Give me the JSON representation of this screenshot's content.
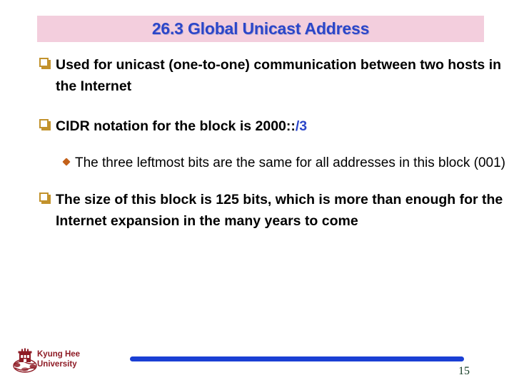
{
  "slide": {
    "page_number": "15",
    "title": "26.3 Global Unicast Address",
    "title_band_color": "#f3cedd",
    "title_text_color": "#2b46c8"
  },
  "bullets": [
    {
      "level": 1,
      "glyph": "hollow-square-bullet",
      "glyph_color": "#c2922c",
      "text": "Used for unicast (one-to-one) communication between two hosts in the Internet"
    },
    {
      "level": 1,
      "glyph": "hollow-square-bullet",
      "glyph_color": "#c2922c",
      "text_before": "CIDR notation for the block is 2000::",
      "text_highlight": "/3",
      "highlight_color": "#2b46c8"
    },
    {
      "level": 2,
      "glyph": "diamond-bullet",
      "glyph_color": "#c3611a",
      "text": "The three leftmost bits are the same for all addresses in this block (001)"
    },
    {
      "level": 1,
      "glyph": "hollow-square-bullet",
      "glyph_color": "#c2922c",
      "text": "The size of this block is 125 bits, which is more than enough for the Internet expansion in the many years to come"
    }
  ],
  "footer": {
    "logo": "kyung-hee-university-emblem",
    "university_line1": "Kyung Hee",
    "university_line2": "University",
    "university_color": "#8e1b25",
    "bar_color": "#1a3fd4"
  }
}
